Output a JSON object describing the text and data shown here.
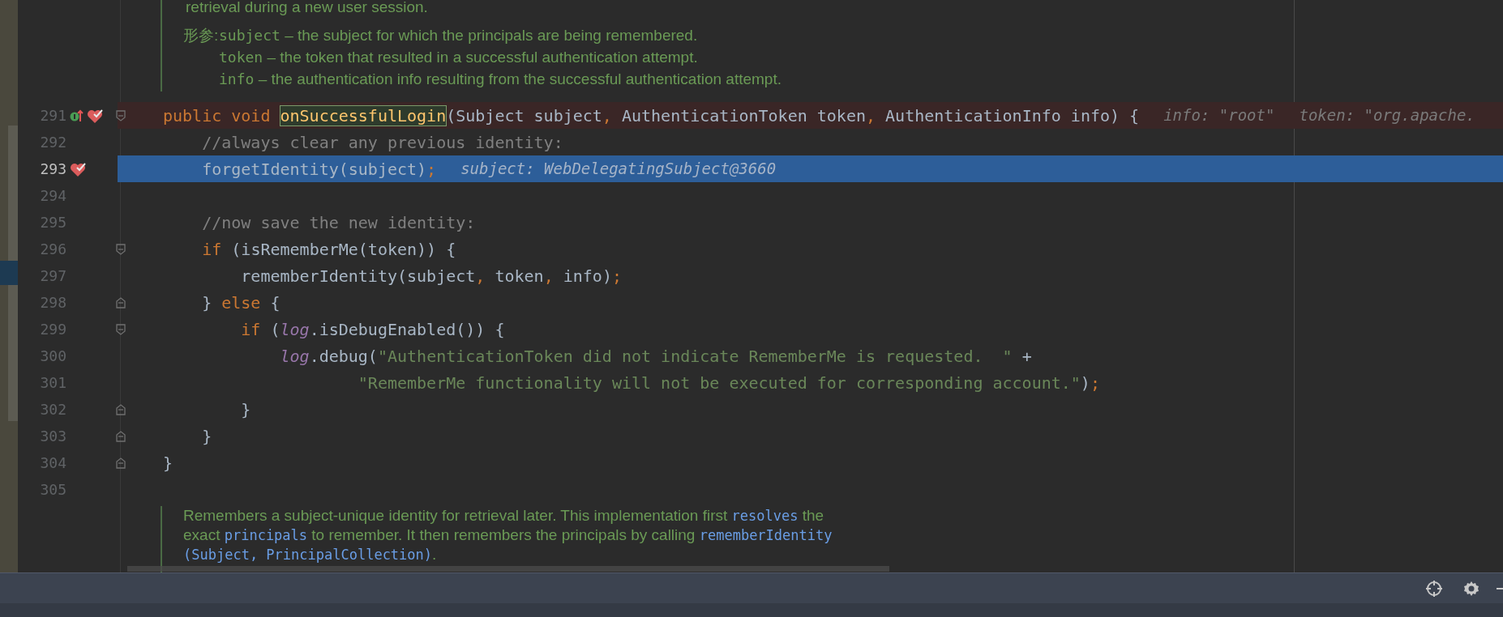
{
  "doc_top": [
    {
      "segments": [
        {
          "kind": "text",
          "text": "retrieval during a new user session."
        }
      ]
    },
    {
      "label": "形参:",
      "segments": [
        {
          "kind": "code",
          "text": "subject"
        },
        {
          "kind": "text",
          "text": " – the subject for which the principals are being remembered."
        }
      ]
    },
    {
      "segments": [
        {
          "kind": "code",
          "text": "token"
        },
        {
          "kind": "text",
          "text": " – the token that resulted in a successful authentication attempt."
        }
      ]
    },
    {
      "segments": [
        {
          "kind": "code",
          "text": "info"
        },
        {
          "kind": "text",
          "text": " – the authentication info resulting from the successful authentication attempt."
        }
      ]
    }
  ],
  "lines": [
    {
      "number": "291",
      "breakpoint": true,
      "current": false,
      "overrides": true,
      "fold_start": true,
      "fold_end": false,
      "tokens": [
        {
          "kind": "keyword",
          "text": "public void "
        },
        {
          "kind": "decl",
          "text": "onSuccessfulLogin"
        },
        {
          "kind": "plain",
          "text": "(Subject subject"
        },
        {
          "kind": "punct",
          "text": ", "
        },
        {
          "kind": "plain",
          "text": "AuthenticationToken token"
        },
        {
          "kind": "punct",
          "text": ", "
        },
        {
          "kind": "plain",
          "text": "AuthenticationInfo info) {"
        }
      ],
      "hints": [
        "info: \"root\"",
        "token: \"org.apache."
      ]
    },
    {
      "number": "292",
      "breakpoint": false,
      "current": false,
      "overrides": false,
      "fold_start": false,
      "fold_end": false,
      "tokens": [
        {
          "kind": "comment",
          "text": "    //always clear any previous identity:"
        }
      ]
    },
    {
      "number": "293",
      "breakpoint": true,
      "current": true,
      "overrides": false,
      "fold_start": false,
      "fold_end": false,
      "tokens": [
        {
          "kind": "plain",
          "text": "    forgetIdentity(subject)"
        },
        {
          "kind": "punct",
          "text": ";"
        }
      ],
      "hints": [
        "subject: WebDelegatingSubject@3660"
      ]
    },
    {
      "number": "294",
      "breakpoint": false,
      "current": false,
      "overrides": false,
      "fold_start": false,
      "fold_end": false
    },
    {
      "number": "295",
      "breakpoint": false,
      "current": false,
      "overrides": false,
      "fold_start": false,
      "fold_end": false,
      "tokens": [
        {
          "kind": "comment",
          "text": "    //now save the new identity:"
        }
      ]
    },
    {
      "number": "296",
      "breakpoint": false,
      "current": false,
      "overrides": false,
      "fold_start": true,
      "fold_end": false,
      "tokens": [
        {
          "kind": "keyword",
          "text": "    if "
        },
        {
          "kind": "plain",
          "text": "(isRememberMe(token)) {"
        }
      ]
    },
    {
      "number": "297",
      "breakpoint": false,
      "current": false,
      "overrides": false,
      "fold_start": false,
      "fold_end": false,
      "tokens": [
        {
          "kind": "plain",
          "text": "        rememberIdentity(subject"
        },
        {
          "kind": "punct",
          "text": ", "
        },
        {
          "kind": "plain",
          "text": "token"
        },
        {
          "kind": "punct",
          "text": ", "
        },
        {
          "kind": "plain",
          "text": "info)"
        },
        {
          "kind": "punct",
          "text": ";"
        }
      ]
    },
    {
      "number": "298",
      "breakpoint": false,
      "current": false,
      "overrides": false,
      "fold_start": false,
      "fold_end": true,
      "tokens": [
        {
          "kind": "plain",
          "text": "    } "
        },
        {
          "kind": "keyword",
          "text": "else "
        },
        {
          "kind": "plain",
          "text": "{"
        }
      ]
    },
    {
      "number": "299",
      "breakpoint": false,
      "current": false,
      "overrides": false,
      "fold_start": true,
      "fold_end": false,
      "tokens": [
        {
          "kind": "keyword",
          "text": "        if "
        },
        {
          "kind": "plain",
          "text": "("
        },
        {
          "kind": "field",
          "text": "log"
        },
        {
          "kind": "plain",
          "text": ".isDebugEnabled()) {"
        }
      ]
    },
    {
      "number": "300",
      "breakpoint": false,
      "current": false,
      "overrides": false,
      "fold_start": false,
      "fold_end": false,
      "tokens": [
        {
          "kind": "field",
          "text": "            log"
        },
        {
          "kind": "plain",
          "text": ".debug("
        },
        {
          "kind": "string",
          "text": "\"AuthenticationToken did not indicate RememberMe is requested.  \""
        },
        {
          "kind": "plain",
          "text": " +"
        }
      ]
    },
    {
      "number": "301",
      "breakpoint": false,
      "current": false,
      "overrides": false,
      "fold_start": false,
      "fold_end": false,
      "tokens": [
        {
          "kind": "string",
          "text": "                    \"RememberMe functionality will not be executed for corresponding account.\""
        },
        {
          "kind": "plain",
          "text": ")"
        },
        {
          "kind": "punct",
          "text": ";"
        }
      ]
    },
    {
      "number": "302",
      "breakpoint": false,
      "current": false,
      "overrides": false,
      "fold_start": false,
      "fold_end": true,
      "tokens": [
        {
          "kind": "plain",
          "text": "        }"
        }
      ]
    },
    {
      "number": "303",
      "breakpoint": false,
      "current": false,
      "overrides": false,
      "fold_start": false,
      "fold_end": true,
      "tokens": [
        {
          "kind": "plain",
          "text": "    }"
        }
      ]
    },
    {
      "number": "304",
      "breakpoint": false,
      "current": false,
      "overrides": false,
      "fold_start": false,
      "fold_end": true,
      "tokens": [
        {
          "kind": "plain",
          "text": "}"
        }
      ]
    },
    {
      "number": "305",
      "breakpoint": false,
      "current": false,
      "overrides": false,
      "fold_start": false,
      "fold_end": false
    }
  ],
  "doc_bottom": [
    [
      {
        "kind": "text",
        "text": "Remembers a subject-unique identity for retrieval later. This implementation first "
      },
      {
        "kind": "link",
        "text": "resolves"
      },
      {
        "kind": "text",
        "text": " the"
      }
    ],
    [
      {
        "kind": "text",
        "text": "exact "
      },
      {
        "kind": "link",
        "text": "principals"
      },
      {
        "kind": "text",
        "text": " to remember. It then remembers the principals by calling "
      },
      {
        "kind": "link",
        "text": "rememberIdentity"
      }
    ],
    [
      {
        "kind": "link",
        "text": "(Subject, PrincipalCollection)"
      },
      {
        "kind": "text",
        "text": "."
      }
    ]
  ]
}
